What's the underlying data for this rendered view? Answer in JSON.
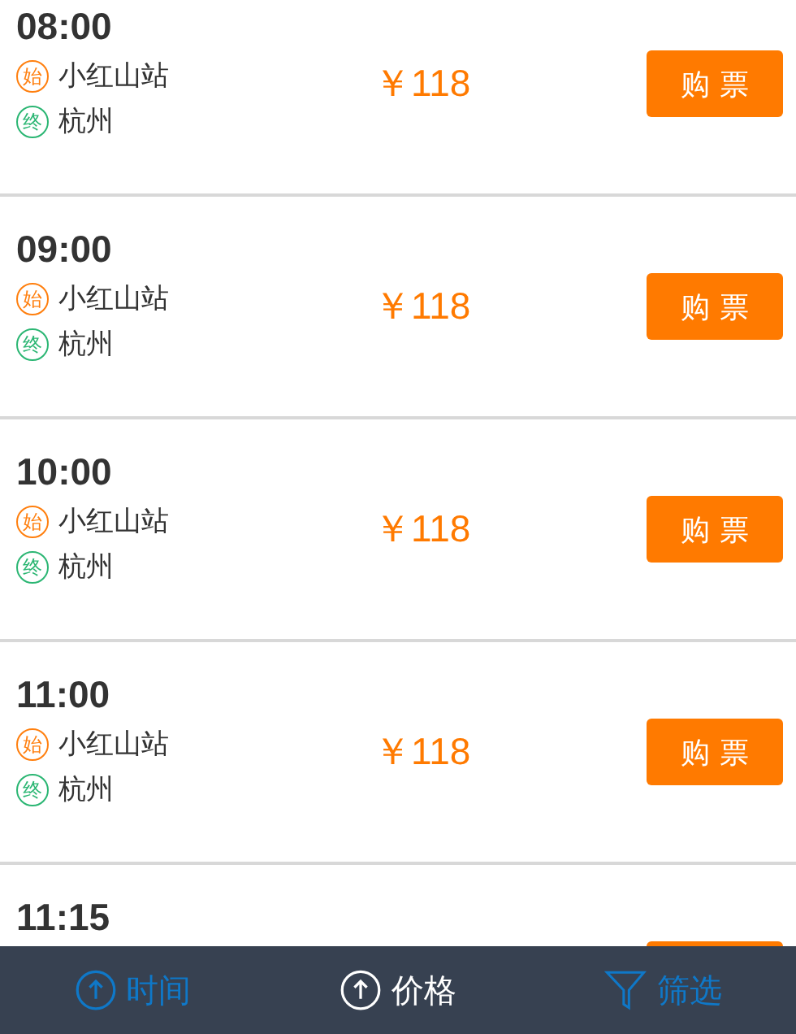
{
  "trips": [
    {
      "time": "08:00",
      "start_mark": "始",
      "start": "小红山站",
      "end_mark": "终",
      "end": "杭州",
      "price": "￥118",
      "button": "购 票"
    },
    {
      "time": "09:00",
      "start_mark": "始",
      "start": "小红山站",
      "end_mark": "终",
      "end": "杭州",
      "price": "￥118",
      "button": "购 票"
    },
    {
      "time": "10:00",
      "start_mark": "始",
      "start": "小红山站",
      "end_mark": "终",
      "end": "杭州",
      "price": "￥118",
      "button": "购 票"
    },
    {
      "time": "11:00",
      "start_mark": "始",
      "start": "小红山站",
      "end_mark": "终",
      "end": "杭州",
      "price": "￥118",
      "button": "购 票"
    },
    {
      "time": "11:15"
    }
  ],
  "sort_bar": [
    {
      "kind": "sort",
      "label": "时间",
      "selected": false
    },
    {
      "kind": "sort",
      "label": "价格",
      "selected": true
    },
    {
      "kind": "filter",
      "label": "筛选",
      "selected": false
    }
  ]
}
